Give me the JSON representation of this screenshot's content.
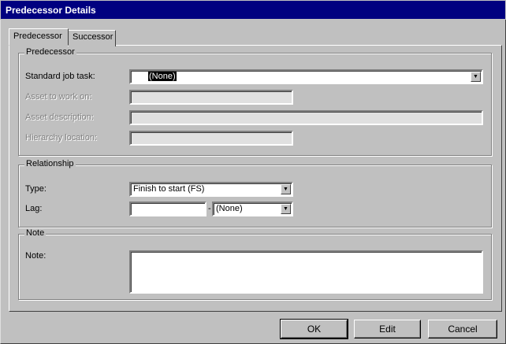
{
  "window": {
    "title": "Predecessor Details"
  },
  "tabs": [
    {
      "label": "Predecessor",
      "active": true
    },
    {
      "label": "Successor",
      "active": false
    }
  ],
  "predecessor_group": {
    "label": "Predecessor",
    "standard_job_task": {
      "label": "Standard job task:",
      "value": "(None)"
    },
    "asset_to_work_on": {
      "label": "Asset to work on:",
      "value": ""
    },
    "asset_description": {
      "label": "Asset description:",
      "value": ""
    },
    "hierarchy_location": {
      "label": "Hierarchy location:",
      "value": ""
    }
  },
  "relationship_group": {
    "label": "Relationship",
    "type": {
      "label": "Type:",
      "value": "Finish to start (FS)"
    },
    "lag": {
      "label": "Lag:",
      "value": "",
      "separator": "-",
      "unit": "(None)"
    }
  },
  "note_group": {
    "label": "Note",
    "note": {
      "label": "Note:",
      "value": ""
    }
  },
  "buttons": {
    "ok": "OK",
    "edit": "Edit",
    "cancel": "Cancel"
  }
}
